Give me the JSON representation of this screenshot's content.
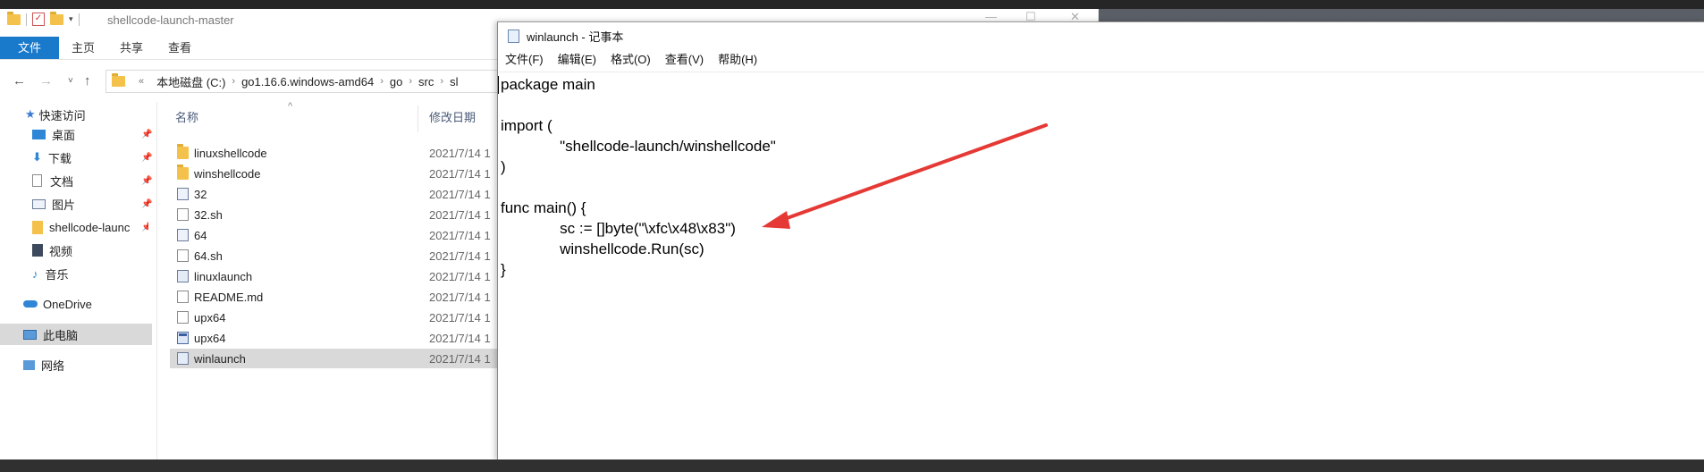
{
  "explorer": {
    "window_title": "shellcode-launch-master",
    "ribbon_tabs": [
      "文件",
      "主页",
      "共享",
      "查看"
    ],
    "breadcrumb": [
      "«",
      "本地磁盘 (C:)",
      "go1.16.6.windows-amd64",
      "go",
      "src",
      "sl"
    ],
    "nav_pane": {
      "quick_access": "快速访问",
      "items": [
        "桌面",
        "下载",
        "文档",
        "图片",
        "shellcode-launc",
        "视频",
        "音乐"
      ],
      "onedrive": "OneDrive",
      "this_pc": "此电脑",
      "network": "网络"
    },
    "columns": {
      "name": "名称",
      "date": "修改日期"
    },
    "files": [
      {
        "name": "linuxshellcode",
        "date": "2021/7/14 1",
        "icon": "folder-icon"
      },
      {
        "name": "winshellcode",
        "date": "2021/7/14 1",
        "icon": "folder-icon"
      },
      {
        "name": "32",
        "date": "2021/7/14 1",
        "icon": "image-file-icon"
      },
      {
        "name": "32.sh",
        "date": "2021/7/14 1",
        "icon": "document-icon"
      },
      {
        "name": "64",
        "date": "2021/7/14 1",
        "icon": "image-file-icon"
      },
      {
        "name": "64.sh",
        "date": "2021/7/14 1",
        "icon": "document-icon"
      },
      {
        "name": "linuxlaunch",
        "date": "2021/7/14 1",
        "icon": "file-icon"
      },
      {
        "name": "README.md",
        "date": "2021/7/14 1",
        "icon": "document-icon"
      },
      {
        "name": "upx64",
        "date": "2021/7/14 1",
        "icon": "document-icon"
      },
      {
        "name": "upx64",
        "date": "2021/7/14 1",
        "icon": "application-icon"
      },
      {
        "name": "winlaunch",
        "date": "2021/7/14 1",
        "icon": "file-icon"
      }
    ],
    "selected_file": "winlaunch"
  },
  "notepad": {
    "title": "winlaunch - 记事本",
    "menu": [
      "文件(F)",
      "编辑(E)",
      "格式(O)",
      "查看(V)",
      "帮助(H)"
    ],
    "code_lines": [
      "package main",
      "",
      "import (",
      "              \"shellcode-launch/winshellcode\"",
      ")",
      "",
      "func main() {",
      "              sc := []byte(\"\\xfc\\x48\\x83\")",
      "              winshellcode.Run(sc)",
      "}"
    ]
  },
  "colors": {
    "ribbon_active": "#1979ca",
    "selection": "#d9d9d9",
    "annotation_arrow": "#e53935",
    "folder": "#f4c24a"
  }
}
